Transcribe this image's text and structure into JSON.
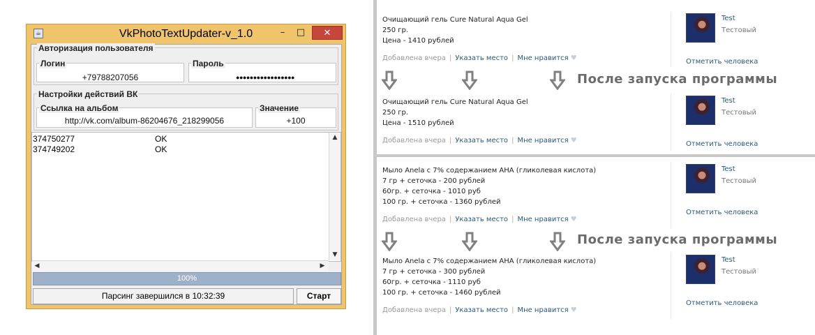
{
  "window": {
    "title": "VkPhotoTextUpdater-v_1.0",
    "controls": {
      "minimize": "–",
      "maximize": "□",
      "close": "✕"
    },
    "auth_group": {
      "title": "Авторизация пользователя",
      "login_label": "Логин",
      "login_value": "+79788207056",
      "password_label": "Пароль",
      "password_value": "●●●●●●●●●●●●●●●●●"
    },
    "vk_group": {
      "title": "Настройки действий ВК",
      "album_label": "Ссылка на альбом",
      "album_value": "http://vk.com/album-86204676_218299056",
      "value_label": "Значение",
      "value_value": "+100"
    },
    "results": [
      {
        "id": "374750277",
        "status": "OK"
      },
      {
        "id": "374749202",
        "status": "OK"
      }
    ],
    "scroll_arrows": {
      "up": "▲",
      "down": "▼",
      "left": "◀",
      "right": "▶"
    },
    "progress": {
      "percent": 100,
      "label": "100%"
    },
    "status": "Парсинг завершился в 10:32:39",
    "start_button": "Старт"
  },
  "posts": [
    {
      "lines": [
        "Очищающий гель Cure Natural Aqua Gel",
        "250 гр.",
        "Цена - 1410 рублей"
      ],
      "added": "Добавлена вчера",
      "place": "Указать место",
      "like": "Мне нравится",
      "user": "Test",
      "user_sub": "Тестовый",
      "tag": "Отметить человека"
    },
    {
      "lines": [
        "Очищающий гель Cure Natural Aqua Gel",
        "250 гр.",
        "Цена - 1510 рублей"
      ],
      "added": "Добавлена вчера",
      "place": "Указать место",
      "like": "Мне нравится",
      "user": "Test",
      "user_sub": "Тестовый",
      "tag": "Отметить человека"
    },
    {
      "lines": [
        "Мыло Anela с 7% содержанием АНА (гликолевая кислота)",
        "7 гр + сеточка - 200 рублей",
        "60гр. + сеточка - 1010 руб",
        "100 гр. + сеточка - 1360 рублей"
      ],
      "added": "Добавлена вчера",
      "place": "Указать место",
      "like": "Мне нравится",
      "user": "Test",
      "user_sub": "Тестовый",
      "tag": "Отметить человека"
    },
    {
      "lines": [
        "Мыло Anela с 7% содержанием АНА (гликолевая кислота)",
        "7 гр + сеточка - 300 рублей",
        "60гр. + сеточка - 1110 руб",
        "100 гр. + сеточка - 1460 рублей"
      ],
      "added": "Добавлена вчера",
      "place": "Указать место",
      "like": "Мне нравится",
      "user": "Test",
      "user_sub": "Тестовый",
      "tag": "Отметить человека"
    }
  ],
  "after_label": "После запуска программы",
  "colors": {
    "window_frame": "#f0c46b",
    "close_button": "#c7463b",
    "progress": "#9fb1c9",
    "vk_link": "#2b587a",
    "arrow_gray": "#808080"
  }
}
